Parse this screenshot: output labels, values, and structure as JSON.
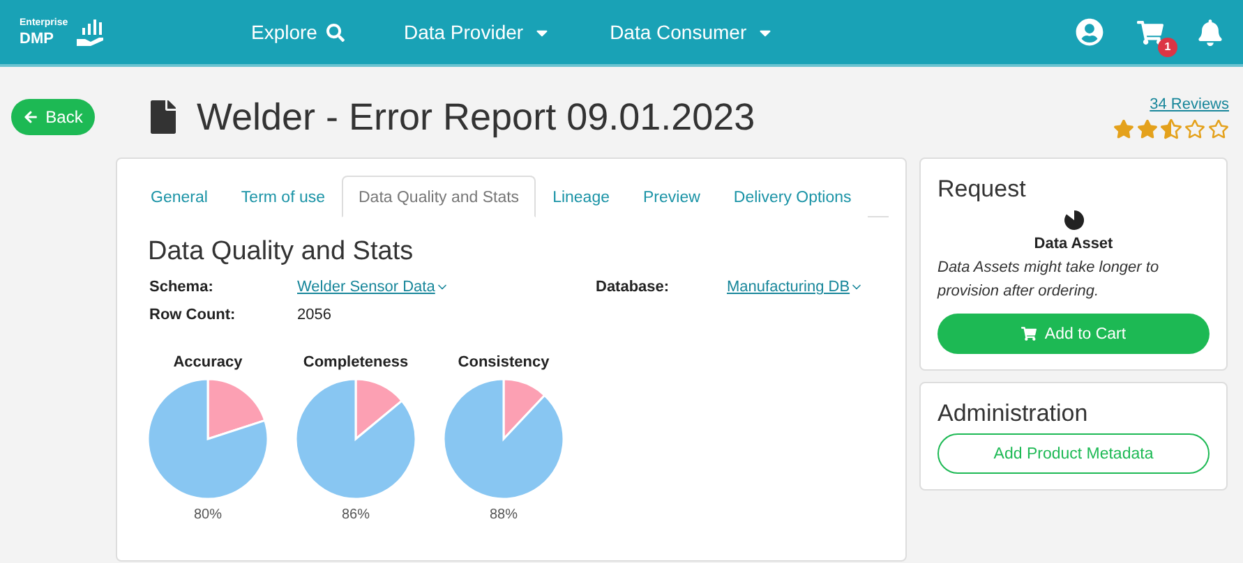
{
  "brand": {
    "small": "Enterprise",
    "large": "DMP"
  },
  "nav": [
    {
      "label": "Explore",
      "kind": "search"
    },
    {
      "label": "Data Provider",
      "kind": "dropdown"
    },
    {
      "label": "Data Consumer",
      "kind": "dropdown"
    }
  ],
  "cart_count": "1",
  "back": "Back",
  "title": "Welder - Error Report 09.01.2023",
  "reviews": {
    "label": "34 Reviews",
    "stars": 2.5
  },
  "tabs": [
    {
      "label": "General",
      "selected": false
    },
    {
      "label": "Term of use",
      "selected": false
    },
    {
      "label": "Data Quality and Stats",
      "selected": true
    },
    {
      "label": "Lineage",
      "selected": false
    },
    {
      "label": "Preview",
      "selected": false
    },
    {
      "label": "Delivery Options",
      "selected": false
    }
  ],
  "section_title": "Data Quality and Stats",
  "fields": [
    {
      "label": "Schema:",
      "value": "Welder Sensor Data",
      "kind": "link"
    },
    {
      "label": "Database:",
      "value": "Manufacturing DB",
      "kind": "link"
    },
    {
      "label": "Row Count:",
      "value": "2056",
      "kind": "text"
    }
  ],
  "charts": [
    {
      "label": "80%",
      "chart_data": {
        "type": "pie",
        "title": "Accuracy",
        "values": [
          80,
          20
        ],
        "colors": [
          "#88c6f2",
          "#fca0b3"
        ]
      }
    },
    {
      "label": "86%",
      "chart_data": {
        "type": "pie",
        "title": "Completeness",
        "values": [
          86,
          14
        ],
        "colors": [
          "#88c6f2",
          "#fca0b3"
        ]
      }
    },
    {
      "label": "88%",
      "chart_data": {
        "type": "pie",
        "title": "Consistency",
        "values": [
          88,
          12
        ],
        "colors": [
          "#88c6f2",
          "#fca0b3"
        ]
      }
    }
  ],
  "request": {
    "title": "Request",
    "asset_type": "Data Asset",
    "note": "Data Assets might take longer to provision after ordering.",
    "button": "Add to Cart"
  },
  "administration": {
    "title": "Administration",
    "button": "Add Product Metadata"
  }
}
